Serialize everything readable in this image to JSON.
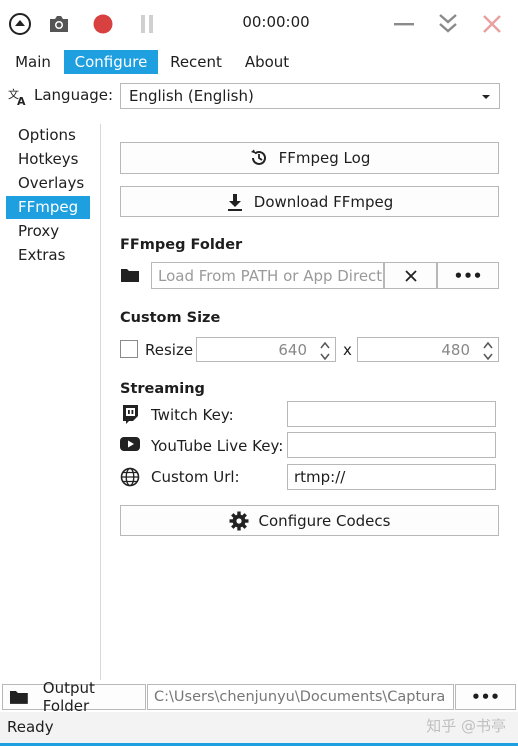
{
  "window": {
    "timer": "00:00:00",
    "icons": [
      "navigate-up-icon",
      "camera-icon",
      "record-icon",
      "pause-icon",
      "minimize-icon",
      "collapse-icon",
      "close-icon"
    ]
  },
  "menu": {
    "items": [
      "Main",
      "Configure",
      "Recent",
      "About"
    ],
    "active": "Configure"
  },
  "language": {
    "label": "Language:",
    "value": "English (English)"
  },
  "sidebar": {
    "items": [
      "Options",
      "Hotkeys",
      "Overlays",
      "FFmpeg",
      "Proxy",
      "Extras"
    ],
    "active": "FFmpeg"
  },
  "ffmpeg": {
    "log_label": "FFmpeg Log",
    "download_label": "Download FFmpeg",
    "folder_title": "FFmpeg Folder",
    "folder_placeholder": "Load From PATH or App Directory",
    "browse_label": "•••"
  },
  "custom_size": {
    "title": "Custom Size",
    "resize_label": "Resize",
    "width": "640",
    "separator": "x",
    "height": "480"
  },
  "streaming": {
    "title": "Streaming",
    "twitch_label": "Twitch Key:",
    "twitch_value": "",
    "youtube_label": "YouTube Live Key:",
    "youtube_value": "",
    "custom_url_label": "Custom Url:",
    "custom_url_value": "rtmp://"
  },
  "codecs": {
    "label": "Configure Codecs"
  },
  "output": {
    "label": "Output Folder",
    "path": "C:\\Users\\chenjunyu\\Documents\\Captura",
    "browse_label": "•••"
  },
  "status": {
    "text": "Ready",
    "watermark": "知乎 @书亭"
  },
  "colors": {
    "accent": "#1e9fe0",
    "record": "#d94040",
    "close": "#e8a0a0"
  }
}
